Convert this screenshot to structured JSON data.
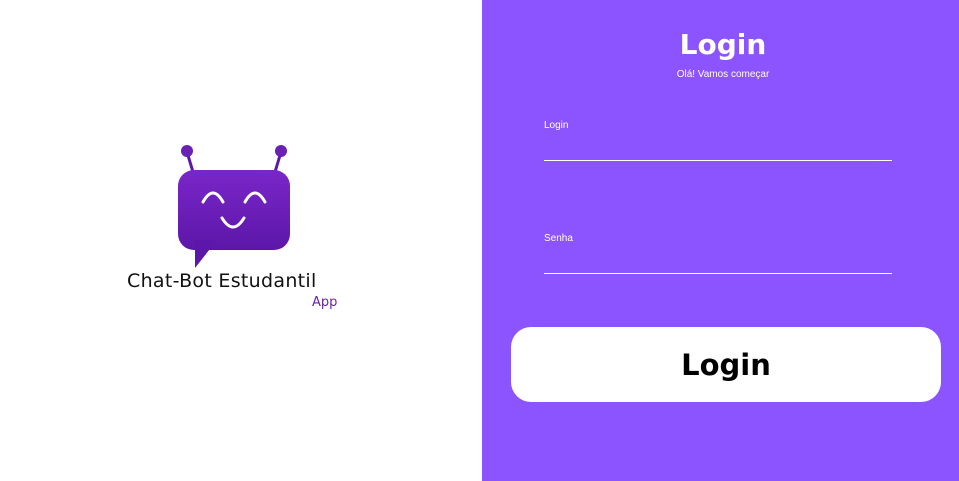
{
  "brand": {
    "name": "Chat-Bot Estudantil",
    "subtitle": "App",
    "logo_icon": "chatbot-robot-icon",
    "logo_color": "#6a1fb5"
  },
  "login_panel": {
    "background_color": "#8c54ff",
    "title": "Login",
    "subtitle": "Olá! Vamos começar",
    "fields": {
      "login": {
        "label": "Login",
        "value": "",
        "placeholder": ""
      },
      "password": {
        "label": "Senha",
        "value": "",
        "placeholder": ""
      }
    },
    "submit_label": "Login"
  }
}
